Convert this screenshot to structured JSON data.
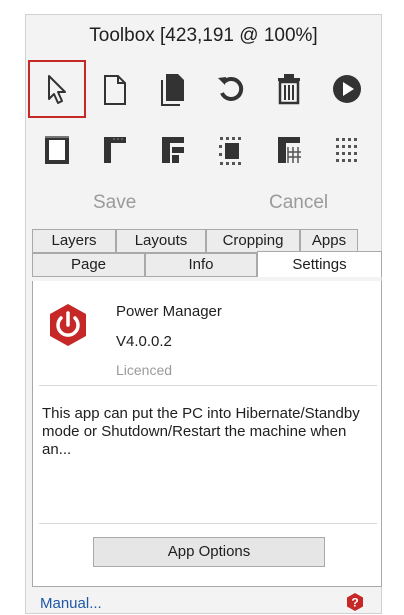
{
  "toolbox": {
    "title": "Toolbox [423,191 @ 100%]"
  },
  "tools_row1": [
    {
      "icon": "pointer-icon",
      "selected": true
    },
    {
      "icon": "new-page-icon"
    },
    {
      "icon": "copy-page-icon"
    },
    {
      "icon": "undo-icon"
    },
    {
      "icon": "delete-icon"
    },
    {
      "icon": "play-icon"
    }
  ],
  "tools_row2": [
    {
      "icon": "page-frame-icon"
    },
    {
      "icon": "corner-edge-icon"
    },
    {
      "icon": "split-layout-icon"
    },
    {
      "icon": "center-block-icon"
    },
    {
      "icon": "grid-layout-icon"
    },
    {
      "icon": "dot-grid-icon"
    }
  ],
  "actions": {
    "save_label": "Save",
    "cancel_label": "Cancel"
  },
  "tabs_top": [
    "Layers",
    "Layouts",
    "Cropping",
    "Apps"
  ],
  "tabs_bottom": [
    "Page",
    "Info",
    "Settings"
  ],
  "active_tab": "Settings",
  "app": {
    "name": "Power Manager",
    "version": "V4.0.0.2",
    "license": "Licenced",
    "description": "This app can put the PC into Hibernate/Standby mode or Shutdown/Restart the machine when an...",
    "options_label": "App Options"
  },
  "footer": {
    "manual_label": "Manual..."
  },
  "colors": {
    "accent_red": "#c62828",
    "link_blue": "#1f57a8"
  }
}
